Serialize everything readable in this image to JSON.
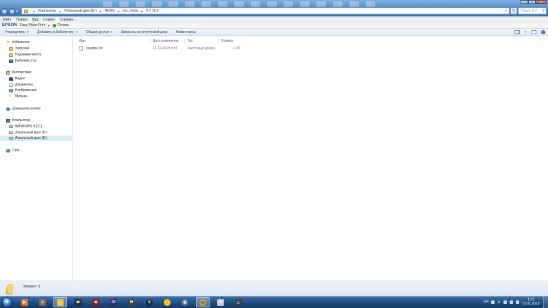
{
  "window": {
    "breadcrumb": [
      "Компьютер",
      "Локальный диск (E:)",
      "WoWs",
      "res_mods",
      "0.7.12.0"
    ],
    "search_placeholder": "Поиск: 0.7...",
    "controls": {
      "minimize": "–",
      "maximize": "□",
      "close": "x"
    }
  },
  "menubar": [
    "Файл",
    "Правка",
    "Вид",
    "Сервис",
    "Справка"
  ],
  "epson": {
    "brand": "EPSON",
    "product": "Easy Photo Print",
    "print_label": "Печать"
  },
  "commandbar": {
    "items": [
      "Упорядочить",
      "Добавить в библиотеку",
      "Общий доступ",
      "Записать на оптический диск",
      "Новая папка"
    ]
  },
  "navpane": {
    "favorites": {
      "label": "Избранное",
      "items": [
        "Загрузки",
        "Недавние места",
        "Рабочий стол"
      ]
    },
    "libraries": {
      "label": "Библиотеки",
      "items": [
        "Видео",
        "Документы",
        "Изображения",
        "Музыка"
      ]
    },
    "homegroup": {
      "label": "Домашняя группа"
    },
    "computer": {
      "label": "Компьютер",
      "items": [
        "WINDOWS 8 (C:)",
        "Локальный диск (D:)",
        "Локальный диск (E:)"
      ]
    },
    "network": {
      "label": "Сеть"
    }
  },
  "columns": {
    "name": "Имя",
    "date": "Дата изменения",
    "type": "Тип",
    "size": "Размер"
  },
  "files": [
    {
      "name": "readme.txt",
      "date": "14.12.2018 6:51",
      "type": "Текстовый докум...",
      "size": "1 КБ"
    }
  ],
  "status": {
    "text": "Элемент: 1"
  },
  "taskbar": {
    "language": "EN",
    "clock_time": "1:21",
    "clock_date": "19.01.2019"
  },
  "colors": {
    "accent": "#3c73ad",
    "selection": "#dceaf8",
    "taskbar": "#1f4a7e"
  }
}
